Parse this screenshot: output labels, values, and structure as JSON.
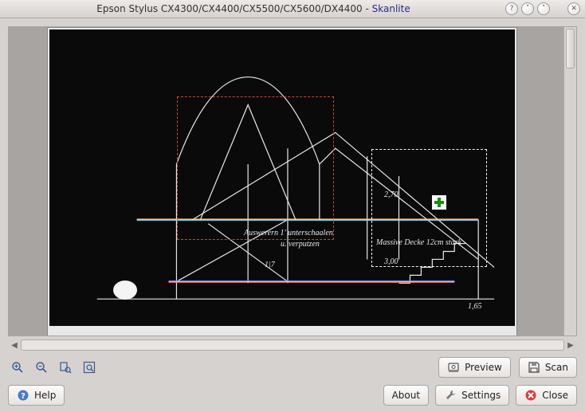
{
  "window": {
    "title_scanner": "Epson Stylus CX4300/CX4400/CX5500/CX5600/DX4400",
    "title_sep": " - ",
    "title_app": "Skanlite"
  },
  "scan_annotations": {
    "label_1_line1": "Auswerern 1' unterschaalen",
    "label_1_line2": "u. verputzen",
    "label_2": "2,70",
    "label_3": "Massive Decke 12cm stark",
    "label_4": "3,00",
    "label_5": "1,65",
    "label_6": "1|7"
  },
  "tools": {
    "zoom_in": "zoom-in",
    "zoom_out": "zoom-out",
    "zoom_fit": "zoom-fit",
    "zoom_actual": "zoom-actual"
  },
  "buttons": {
    "preview": "Preview",
    "scan": "Scan",
    "help": "Help",
    "about": "About",
    "settings": "Settings",
    "close": "Close"
  }
}
